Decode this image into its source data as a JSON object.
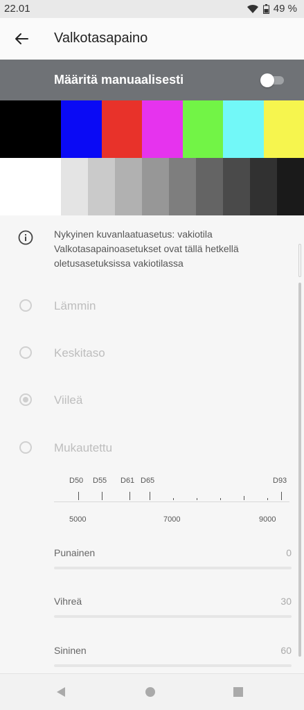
{
  "status_bar": {
    "time": "22.01",
    "battery": "49 %"
  },
  "app_bar": {
    "title": "Valkotasapaino",
    "back_icon": "arrow-left-icon"
  },
  "manual": {
    "label": "Määritä manuaalisesti",
    "enabled": false
  },
  "color_bars": [
    "#000000",
    "#0a0af5",
    "#e8322a",
    "#e633ee",
    "#72f446",
    "#72f8f8",
    "#f6f54e"
  ],
  "gray_bars": [
    "#ffffff",
    "#e4e4e4",
    "#cacaca",
    "#b1b1b1",
    "#979797",
    "#7e7e7e",
    "#646464",
    "#4a4a4a",
    "#313131",
    "#1a1a1a"
  ],
  "info": {
    "line1": "Nykyinen kuvanlaatuasetus: vakiotila",
    "line2": "Valkotasapainoasetukset ovat tällä hetkellä oletusasetuksissa vakiotilassa"
  },
  "options": [
    {
      "label": "Lämmin",
      "selected": false
    },
    {
      "label": "Keskitaso",
      "selected": false
    },
    {
      "label": "Viileä",
      "selected": true
    },
    {
      "label": "Mukautettu",
      "selected": false
    }
  ],
  "temperature": {
    "presets": [
      "D50",
      "D55",
      "D61",
      "D65",
      "D93"
    ],
    "kelvin_labels": [
      "5000",
      "7000",
      "9000"
    ]
  },
  "sliders": [
    {
      "name": "Punainen",
      "value": "0"
    },
    {
      "name": "Vihreä",
      "value": "30"
    },
    {
      "name": "Sininen",
      "value": "60"
    }
  ]
}
